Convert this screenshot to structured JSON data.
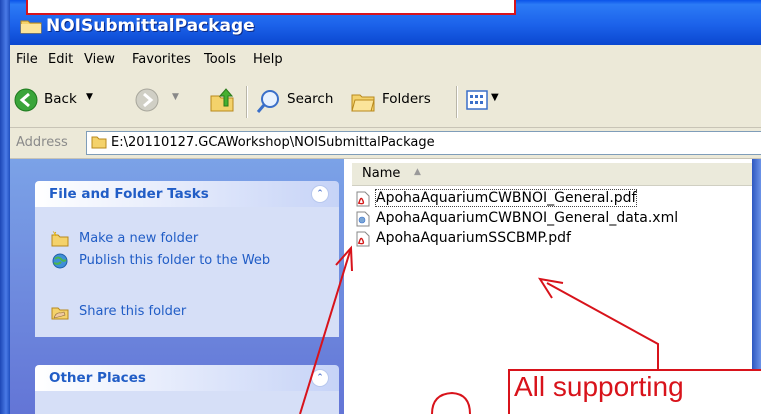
{
  "window": {
    "title": "NOISubmittalPackage"
  },
  "menubar": {
    "items": [
      "File",
      "Edit",
      "View",
      "Favorites",
      "Tools",
      "Help"
    ]
  },
  "toolbar": {
    "back_label": "Back",
    "search_label": "Search",
    "folders_label": "Folders"
  },
  "address": {
    "label": "Address",
    "value": "E:\\20110127.GCAWorkshop\\NOISubmittalPackage"
  },
  "taskpane": {
    "file_tasks": {
      "title": "File and Folder Tasks",
      "items": [
        {
          "label": "Make a new folder",
          "icon": "new-folder-icon"
        },
        {
          "label": "Publish this folder to the Web",
          "icon": "publish-web-icon"
        },
        {
          "label": "Share this folder",
          "icon": "share-folder-icon"
        }
      ]
    },
    "other_places": {
      "title": "Other Places"
    }
  },
  "filelist": {
    "column_name": "Name",
    "files": [
      {
        "name": "ApohaAquariumCWBNOI_General.pdf",
        "icon": "pdf-file-icon"
      },
      {
        "name": "ApohaAquariumCWBNOI_General_data.xml",
        "icon": "xml-file-icon"
      },
      {
        "name": "ApohaAquariumSSCBMP.pdf",
        "icon": "pdf-file-icon"
      }
    ]
  },
  "annotations": {
    "bottom_callout": "All supporting",
    "accent_color": "#d8131b"
  }
}
